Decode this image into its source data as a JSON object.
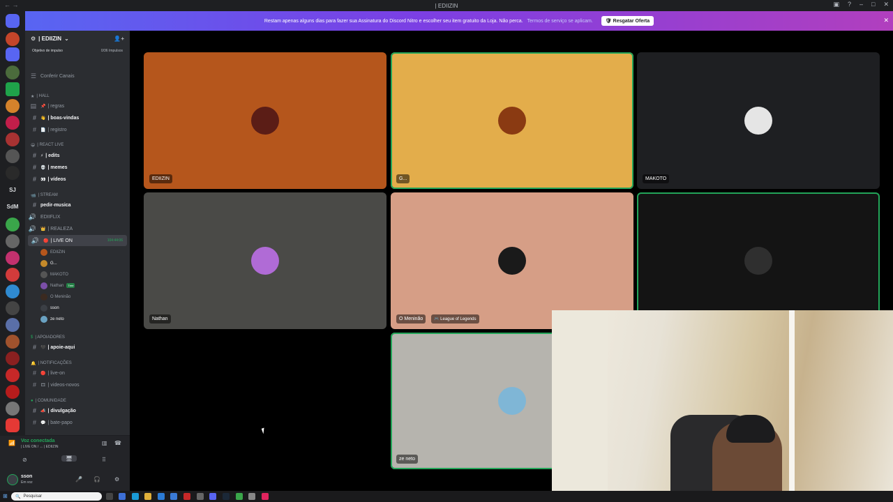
{
  "window": {
    "title": "| EDIIZIN"
  },
  "banner": {
    "message": "Restam apenas alguns dias para fazer sua Assinatura do Discord Nitro e escolher seu item gratuito da Loja. Não perca.",
    "terms": "Termos de serviço se aplicam.",
    "cta": "Resgatar Oferta"
  },
  "server": {
    "name": "| EDIIZIN",
    "boost_label": "Objetivo de impulso",
    "boost_value": "0/36 Impulsos",
    "browse": "Conferir Canais"
  },
  "categories": {
    "hall": "| HALL",
    "react": "| REACT LIVE",
    "stream": "| STREAM",
    "apoiadores": "| APOIADORES",
    "notificacoes": "| NOTIFICAÇÕES",
    "comunidade": "| COMUNIDADE"
  },
  "channels": {
    "regras": "| regras",
    "boas_vindas": "| boas-vindas",
    "registro": "| registro",
    "edits": "| edits",
    "memes": "| memes",
    "videos": "| vídeos",
    "pedir_musica": "pedir-musica",
    "ediiflix": "EDIIFLIX",
    "realeza": "| REALEZA",
    "live_on": "| LIVE ON",
    "live_timer": "104:44:06",
    "apoie_aqui": "| apoie-aqui",
    "live_on_notif": "| live-on",
    "videos_novos": "| videos-novos",
    "divulgacao": "| divulgação",
    "bate_papo": "| bate-papo"
  },
  "voice_users": [
    {
      "name": "EDIIZIN",
      "color": "#b5561c"
    },
    {
      "name": "G...",
      "color": "#c58a2a"
    },
    {
      "name": "MAKOTO",
      "color": "#555"
    },
    {
      "name": "Nathan",
      "color": "#7b4fa8",
      "badge": "Tree"
    },
    {
      "name": "O Meninão",
      "color": "#3b2a20"
    },
    {
      "name": "sson",
      "color": "#3b3f45"
    },
    {
      "name": "ze neto",
      "color": "#6aa2c2"
    }
  ],
  "voice_panel": {
    "status": "Voz conectada",
    "channel": "| LIVE ON / ↔ | EDIIZIN"
  },
  "user": {
    "name": "sson",
    "status": "Em voz"
  },
  "tiles": [
    {
      "name": "EDIIZIN",
      "bg": "#b5561c",
      "avatar": "#5b1d16"
    },
    {
      "name": "G...",
      "bg": "#e3ad4b",
      "avatar": "#8a3a12"
    },
    {
      "name": "MAKOTO",
      "bg": "#1e1f22",
      "avatar": "#e5e5e5"
    },
    {
      "name": "Nathan",
      "bg": "#4a4a47",
      "avatar": "#b06bd6"
    },
    {
      "name": "O Meninão",
      "activity": "League of Legends",
      "bg": "#d69e86",
      "avatar": "#1a1a1a"
    },
    {
      "name": "",
      "bg": "#141414",
      "avatar": "#2f2f2f"
    },
    {
      "name": "ze neto",
      "bg": "#b6b4ae",
      "avatar": "#7fb6d6"
    }
  ],
  "taskbar": {
    "search": "Pesquisar"
  }
}
